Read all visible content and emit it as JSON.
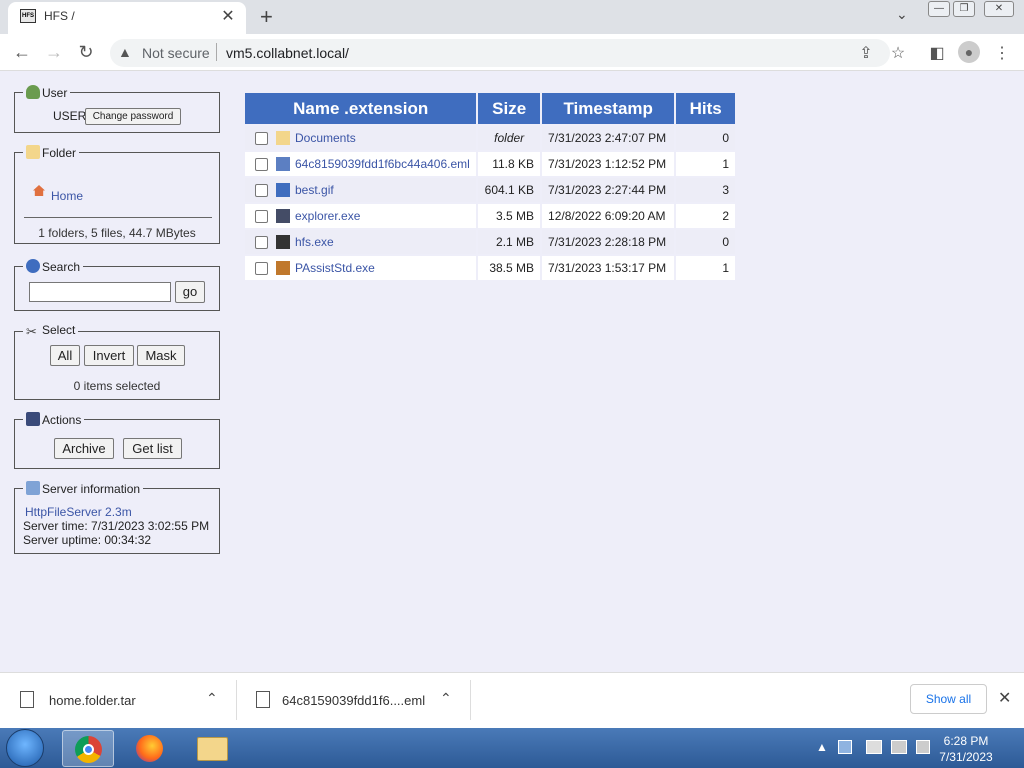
{
  "browser": {
    "tab_title": "HFS /",
    "tab_close": "✕",
    "new_tab": "+",
    "tab_search": "⌄",
    "window_buttons": [
      "—",
      "❐",
      "✕"
    ],
    "security_label": "Not secure",
    "url": "vm5.collabnet.local/"
  },
  "sidebar": {
    "user": {
      "legend": "User",
      "name": "USER",
      "change_password": "Change password"
    },
    "folder": {
      "legend": "Folder",
      "home": "Home",
      "summary": "1 folders, 5 files, 44.7 MBytes"
    },
    "search": {
      "legend": "Search",
      "go": "go",
      "value": ""
    },
    "select": {
      "legend": "Select",
      "all": "All",
      "invert": "Invert",
      "mask": "Mask",
      "status": "0 items selected"
    },
    "actions": {
      "legend": "Actions",
      "archive": "Archive",
      "get_list": "Get list"
    },
    "server": {
      "legend": "Server information",
      "link": "HttpFileServer 2.3m",
      "time": "Server time: 7/31/2023 3:02:55 PM",
      "uptime": "Server uptime: 00:34:32"
    }
  },
  "table": {
    "headers": [
      "Name .extension",
      "Size",
      "Timestamp",
      "Hits"
    ],
    "rows": [
      {
        "name": "Documents",
        "size": "folder",
        "time": "7/31/2023 2:47:07 PM",
        "hits": "0",
        "icon": "folder-icon"
      },
      {
        "name": "64c8159039fdd1f6bc44a406.eml",
        "size": "11.8 KB",
        "time": "7/31/2023 1:12:52 PM",
        "hits": "1",
        "icon": "email-file-icon"
      },
      {
        "name": "best.gif",
        "size": "604.1 KB",
        "time": "7/31/2023 2:27:44 PM",
        "hits": "3",
        "icon": "image-file-icon"
      },
      {
        "name": "explorer.exe",
        "size": "3.5 MB",
        "time": "12/8/2022 6:09:20 AM",
        "hits": "2",
        "icon": "exe-file-icon"
      },
      {
        "name": "hfs.exe",
        "size": "2.1 MB",
        "time": "7/31/2023 2:28:18 PM",
        "hits": "0",
        "icon": "hfs-exe-icon"
      },
      {
        "name": "PAssistStd.exe",
        "size": "38.5 MB",
        "time": "7/31/2023 1:53:17 PM",
        "hits": "1",
        "icon": "installer-icon"
      }
    ]
  },
  "downloads": {
    "items": [
      {
        "name": "home.folder.tar"
      },
      {
        "name": "64c8159039fdd1f6....eml"
      }
    ],
    "show_all": "Show all",
    "close": "✕"
  },
  "taskbar": {
    "time": "6:28 PM",
    "date": "7/31/2023"
  },
  "colors": {
    "page_bg": "#eeeef9",
    "header_bg": "#3f6dbf",
    "link": "#3b55a6"
  }
}
